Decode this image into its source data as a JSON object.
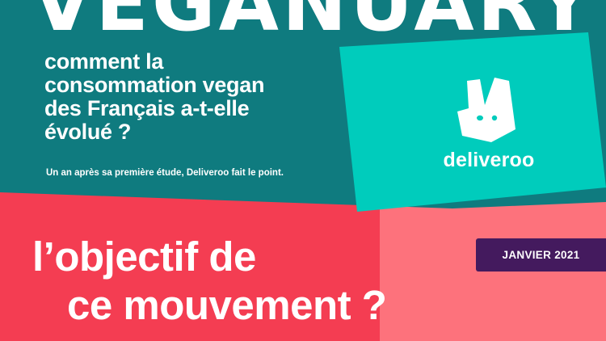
{
  "title_word": "VEGANUARY",
  "headline": {
    "lines": [
      "comment la",
      "consommation vegan",
      "des Français a-t-elle",
      "évolué ?"
    ]
  },
  "subline": "Un an après sa première étude, Deliveroo fait le point.",
  "brand": {
    "name": "deliveroo",
    "icon": "deliveroo-kangaroo-icon"
  },
  "date_badge": "JANVIER 2021",
  "question": {
    "lines": [
      "l’objectif de",
      "ce mouvement ?"
    ]
  },
  "colors": {
    "teal_dark": "#0f7b7f",
    "teal_brand": "#00ccbc",
    "red": "#f43d52",
    "pink": "#fd727c",
    "purple": "#441a5e",
    "white": "#ffffff"
  }
}
